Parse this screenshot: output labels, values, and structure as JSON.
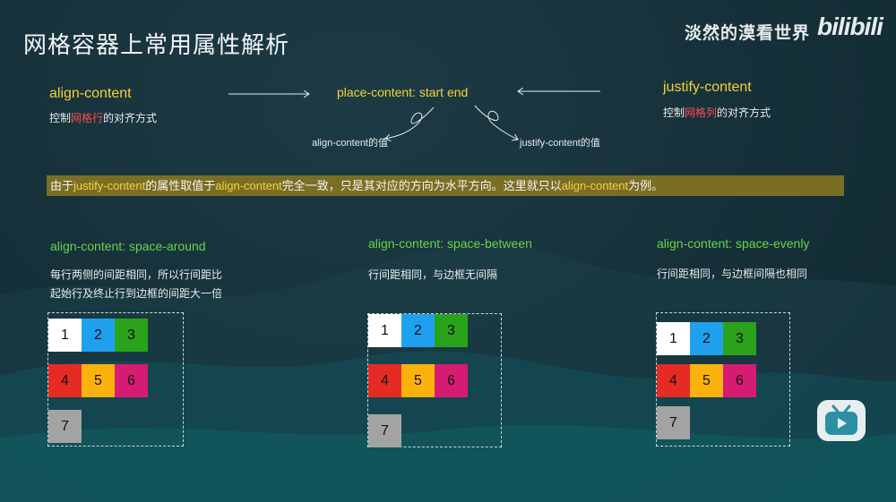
{
  "header": {
    "title": "网格容器上常用属性解析",
    "watermark": "淡然的漠看世界",
    "logo": "bilibili"
  },
  "top": {
    "align_content": "align-content",
    "align_desc_pre": "控制",
    "align_desc_highlight": "网格行",
    "align_desc_post": "的对齐方式",
    "place_content": "place-content: start end",
    "align_value_label": "align-content的值",
    "justify_value_label": "justify-content的值",
    "justify_content": "justify-content",
    "justify_desc_pre": "控制",
    "justify_desc_highlight": "网格列",
    "justify_desc_post": "的对齐方式"
  },
  "banner": {
    "p1": "由于",
    "h1": "justify-content",
    "p2": "的属性取值于",
    "h2": "align-content",
    "p3": "完全一致，只是其对应的方向为水平方向。这里就只以",
    "h3": "align-content",
    "p4": "为例。"
  },
  "examples": [
    {
      "title": "align-content: space-around",
      "desc1": "每行两侧的间距相同，所以行间距比",
      "desc2": "起始行及终止行到边框的间距大一倍"
    },
    {
      "title": "align-content: space-between",
      "desc1": "行间距相同，与边框无间隔"
    },
    {
      "title": "align-content: space-evenly",
      "desc1": "行间距相同，与边框间隔也相同"
    }
  ],
  "cells": [
    "1",
    "2",
    "3",
    "4",
    "5",
    "6",
    "7"
  ],
  "colors": {
    "c1": "#ffffff",
    "c2": "#1fa0ef",
    "c3": "#2aa21b",
    "c4": "#e62b24",
    "c5": "#fbb10e",
    "c6": "#d61c72",
    "c7": "#a3a3a3",
    "accent_yellow": "#f4d23b",
    "accent_green": "#67d44b",
    "accent_red": "#ff4d4f",
    "banner": "#7a6e24"
  },
  "icons": {
    "play": "bilibili-tv-icon"
  }
}
